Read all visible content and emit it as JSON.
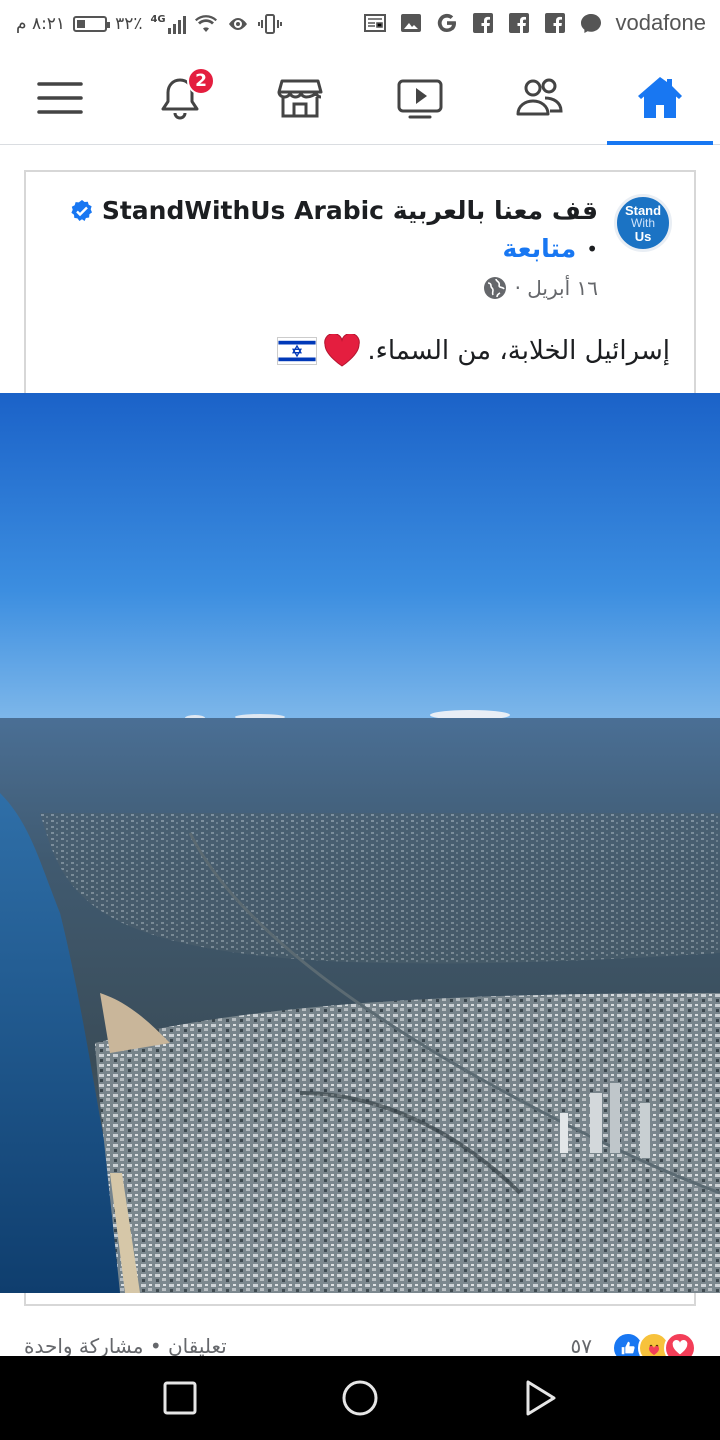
{
  "status_bar": {
    "time": "٨:٢١ م",
    "battery_level": "٣٢٪",
    "network_type": "4G",
    "carrier": "vodafone",
    "battery_fraction": 0.32,
    "icons": [
      "battery-icon",
      "signal-icon",
      "wifi-icon",
      "eye-icon",
      "vibrate-icon",
      "news-icon",
      "gallery-icon",
      "google-icon",
      "facebook-icon",
      "facebook-icon",
      "facebook-icon",
      "messenger-icon"
    ]
  },
  "top_nav": {
    "items": [
      {
        "name": "menu",
        "icon": "hamburger-icon"
      },
      {
        "name": "notifications",
        "icon": "bell-icon",
        "badge": "2"
      },
      {
        "name": "marketplace",
        "icon": "store-icon"
      },
      {
        "name": "watch",
        "icon": "video-icon"
      },
      {
        "name": "groups",
        "icon": "people-icon"
      },
      {
        "name": "home",
        "icon": "home-icon",
        "active": true
      }
    ],
    "accent": "#1877f2"
  },
  "post": {
    "page_name": "قف معنا بالعربية StandWithUs Arabic",
    "avatar_text": {
      "line1": "Stand",
      "line2": "With",
      "line3": "Us"
    },
    "follow_label": "متابعة",
    "separator": "•",
    "date": "١٦ أبريل ·",
    "text": "إسرائيل الخلابة، من السماء.",
    "emoji": [
      "heart-icon",
      "israel-flag-icon"
    ],
    "photo_description_icon": "aerial-city-photo"
  },
  "engagement": {
    "reaction_count": "٥٧",
    "reactions": [
      "like-icon",
      "care-icon",
      "love-icon"
    ],
    "social_counts": "تعليقان • مشاركة واحدة"
  },
  "android_nav": {
    "buttons": [
      "recents-icon",
      "home-circle-icon",
      "back-icon"
    ]
  }
}
